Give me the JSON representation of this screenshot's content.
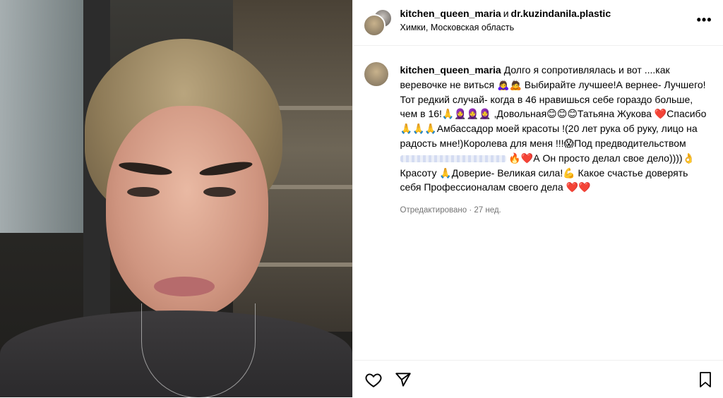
{
  "header": {
    "user1": "kitchen_queen_maria",
    "conj": "и",
    "user2": "dr.kuzindanila.plastic",
    "location": "Химки, Московская область",
    "more_label": "•••"
  },
  "caption": {
    "username": "kitchen_queen_maria",
    "part1": "Долго я сопротивлялась и вот ....как веревочке не виться 🙇‍♀️🙇 Выбирайте лучшее!А вернее- Лучшего!Тот редкий случай- когда в 46 нравишься себе гораздо больше, чем в 16!🙏🧕🧕🧕 ,Довольная😊😊😊Татьяна Жукова ❤️Спасибо🙏🙏🙏Амбассадор моей красоты !(20 лет рука об руку, лицо на радость мне!)Королева для меня !!!😱Под предводительством",
    "part2": "🔥❤️А Он просто делал свое дело))))👌Красоту 🙏Доверие- Великая сила!💪 Какое счастье доверять себя Профессионалам своего дела ❤️❤️",
    "meta": "Отредактировано · 27 нед."
  },
  "icons": {
    "like": "heart-icon",
    "share": "send-icon",
    "save": "bookmark-icon"
  }
}
